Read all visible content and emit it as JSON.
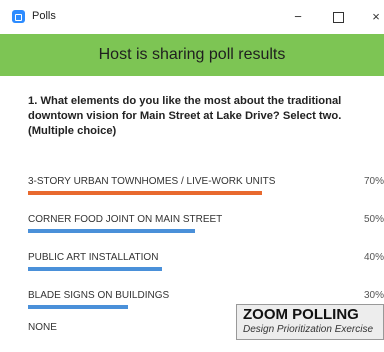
{
  "window": {
    "title": "Polls",
    "minimize_glyph": "−",
    "close_glyph": "×",
    "icon": "zoom-app-icon"
  },
  "banner": {
    "text": "Host is sharing poll results"
  },
  "question": {
    "text": "1. What elements do you like the most about the traditional downtown vision for Main Street at Lake Drive? Select two. (Multiple choice)"
  },
  "options": [
    {
      "label": "3-STORY URBAN TOWNHOMES / LIVE-WORK UNITS",
      "percent_text": "70%",
      "percent": 70,
      "color": "#e8692e"
    },
    {
      "label": "CORNER FOOD JOINT ON MAIN STREET",
      "percent_text": "50%",
      "percent": 50,
      "color": "#4a90d9"
    },
    {
      "label": "PUBLIC ART INSTALLATION",
      "percent_text": "40%",
      "percent": 40,
      "color": "#4a90d9"
    },
    {
      "label": "BLADE SIGNS ON BUILDINGS",
      "percent_text": "30%",
      "percent": 30,
      "color": "#4a90d9"
    },
    {
      "label": "NONE",
      "percent_text": "",
      "percent": 0,
      "color": "#4a90d9"
    }
  ],
  "overlay": {
    "title": "ZOOM POLLING",
    "subtitle": "Design Prioritization Exercise"
  },
  "colors": {
    "banner": "#7dc554",
    "accent": "#e8692e",
    "bar": "#4a90d9"
  }
}
